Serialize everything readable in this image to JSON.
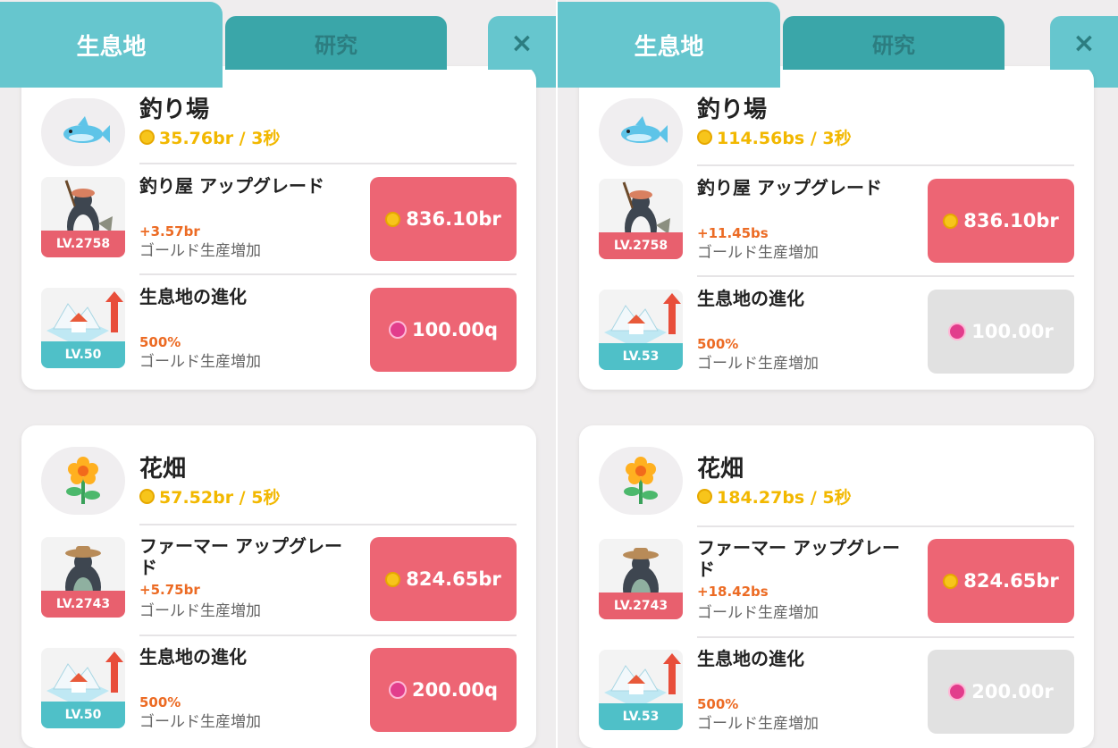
{
  "colors": {
    "tab": "#66c6ce",
    "tab_inactive": "#3aa6a9",
    "button_red": "#ed6574",
    "button_gray": "#e1e1e1",
    "gold": "#f2b800",
    "gain": "#ec6b24",
    "level_red": "#e8606e",
    "level_teal": "#4fc0c8"
  },
  "icons": {
    "fish": "fish-icon",
    "flower": "flower-icon",
    "coin": "gold-coin-icon",
    "gem": "heart-gem-icon",
    "close": "close-icon",
    "evolution": "habitat-evolution-icon"
  },
  "left": {
    "tabs": {
      "active": "生息地",
      "inactive": "研究",
      "close": "×"
    },
    "habitats": [
      {
        "name": "釣り場",
        "rate": "35.76br / 3秒",
        "upgrade": {
          "title": "釣り屋 アップグレード",
          "level": "LV.2758",
          "gain": "+3.57br",
          "desc": "ゴールド生産増加",
          "cost": "836.10br"
        },
        "evolution": {
          "title": "生息地の進化",
          "level": "LV.50",
          "gain": "500%",
          "desc": "ゴールド生産増加",
          "cost": "100.00q"
        }
      },
      {
        "name": "花畑",
        "rate": "57.52br / 5秒",
        "upgrade": {
          "title": "ファーマー アップグレード",
          "level": "LV.2743",
          "gain": "+5.75br",
          "desc": "ゴールド生産増加",
          "cost": "824.65br"
        },
        "evolution": {
          "title": "生息地の進化",
          "level": "LV.50",
          "gain": "500%",
          "desc": "ゴールド生産増加",
          "cost": "200.00q"
        }
      }
    ]
  },
  "right": {
    "tabs": {
      "active": "生息地",
      "inactive": "研究",
      "close": "×"
    },
    "habitats": [
      {
        "name": "釣り場",
        "rate": "114.56bs / 3秒",
        "upgrade": {
          "title": "釣り屋 アップグレード",
          "level": "LV.2758",
          "gain": "+11.45bs",
          "desc": "ゴールド生産増加",
          "cost": "836.10br"
        },
        "evolution": {
          "title": "生息地の進化",
          "level": "LV.53",
          "gain": "500%",
          "desc": "ゴールド生産増加",
          "cost": "100.00r"
        }
      },
      {
        "name": "花畑",
        "rate": "184.27bs / 5秒",
        "upgrade": {
          "title": "ファーマー アップグレード",
          "level": "LV.2743",
          "gain": "+18.42bs",
          "desc": "ゴールド生産増加",
          "cost": "824.65br"
        },
        "evolution": {
          "title": "生息地の進化",
          "level": "LV.53",
          "gain": "500%",
          "desc": "ゴールド生産増加",
          "cost": "200.00r"
        }
      }
    ]
  }
}
